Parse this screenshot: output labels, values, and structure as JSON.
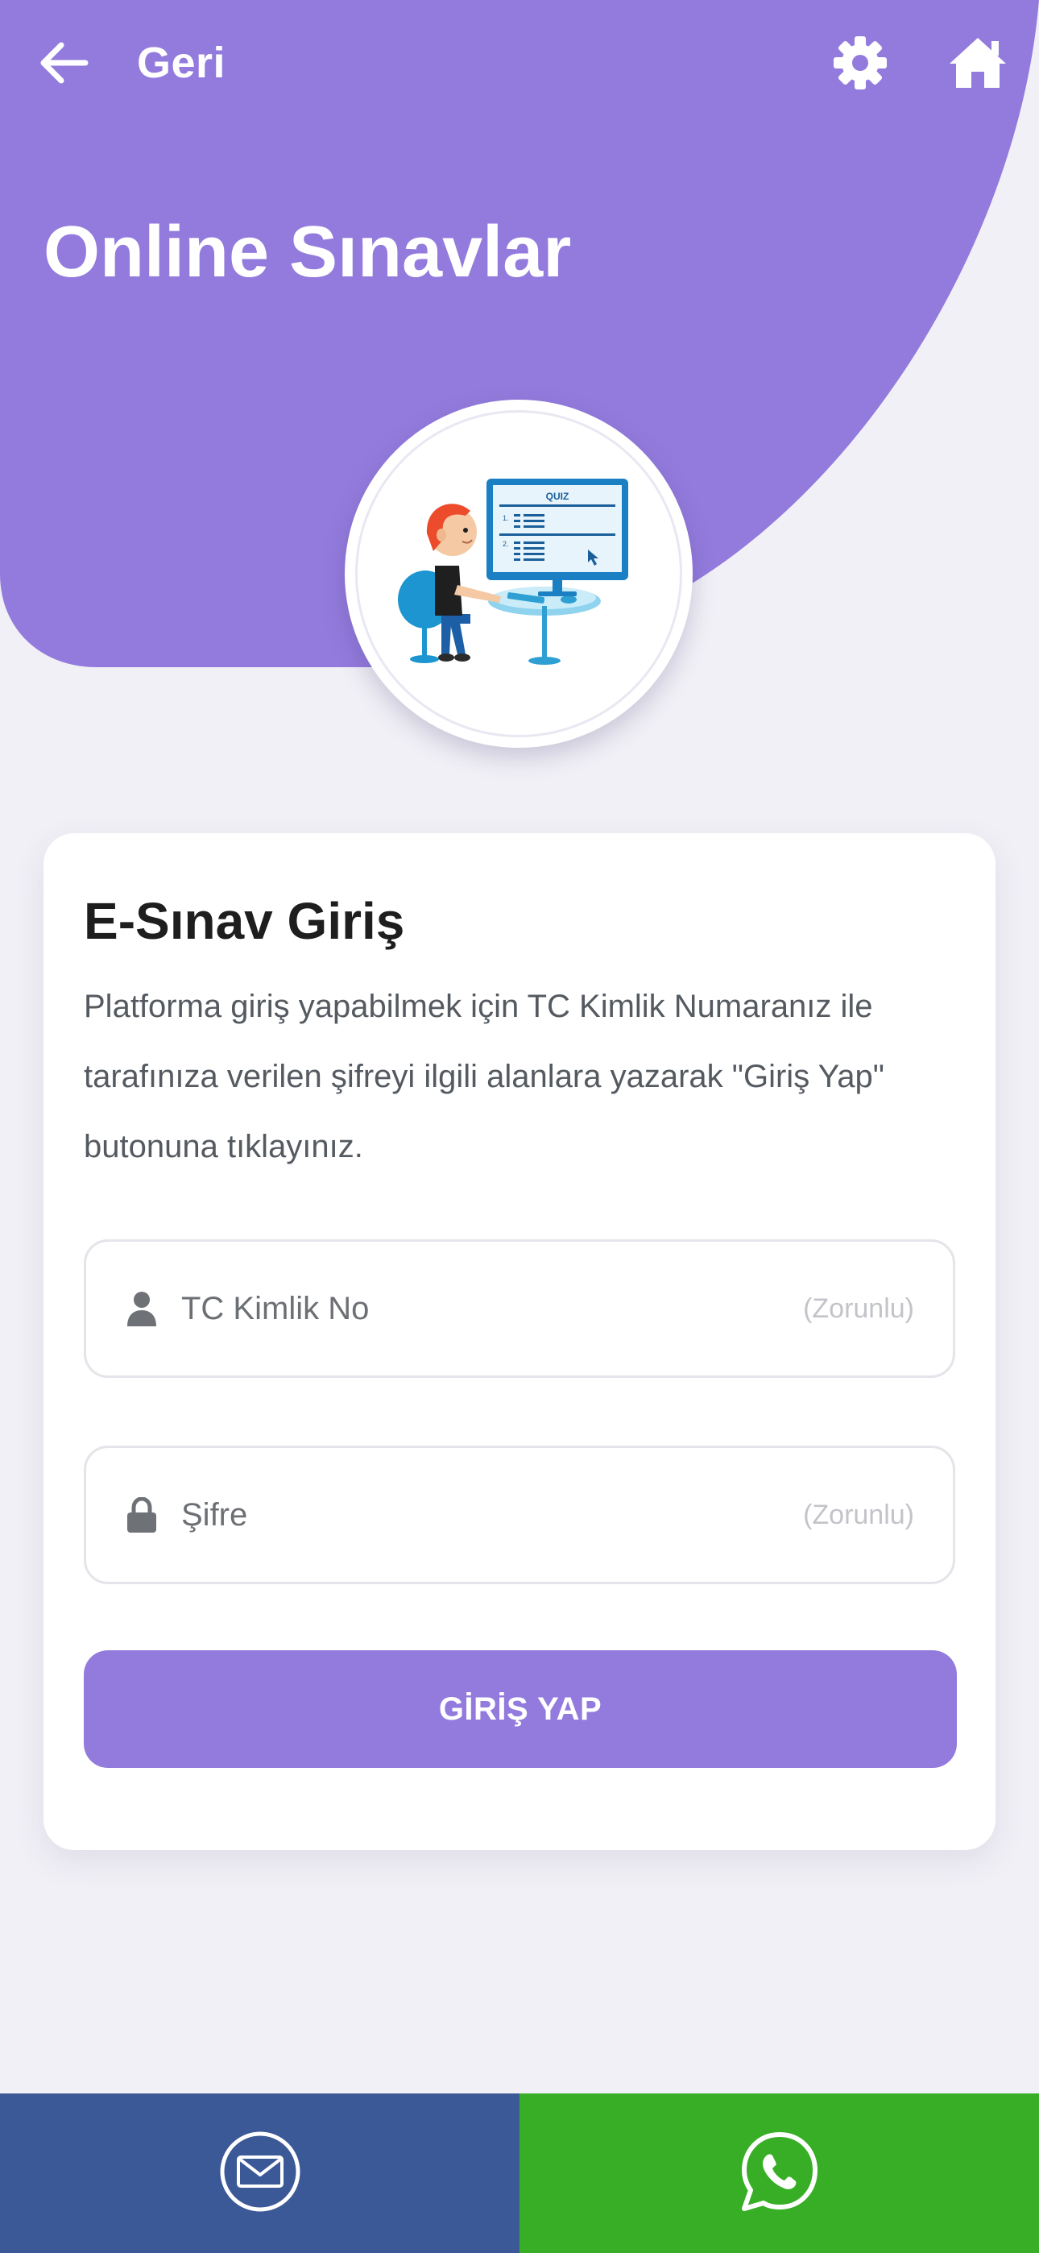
{
  "topbar": {
    "back_label": "Geri",
    "back_icon": "arrow-left-icon",
    "settings_icon": "gear-icon",
    "home_icon": "home-icon"
  },
  "header": {
    "title": "Online Sınavlar",
    "illustration": "quiz-illustration",
    "illustration_text": "QUIZ"
  },
  "login": {
    "title": "E-Sınav Giriş",
    "description": "Platforma giriş yapabilmek için TC Kimlik Numaranız ile tarafınıza verilen şifreyi ilgili alanlara yazarak \"Giriş Yap\" butonuna tıklayınız.",
    "tc_field": {
      "placeholder": "TC Kimlik No",
      "value": "",
      "required_label": "(Zorunlu)",
      "icon": "user-icon"
    },
    "password_field": {
      "placeholder": "Şifre",
      "value": "",
      "required_label": "(Zorunlu)",
      "icon": "lock-icon"
    },
    "submit_label": "GİRİŞ YAP"
  },
  "bottom_bar": {
    "mail_icon": "mail-icon",
    "whatsapp_icon": "whatsapp-icon"
  },
  "colors": {
    "primary": "#937bdd",
    "background": "#f1f0f6",
    "mail": "#3c5997",
    "whatsapp": "#37ae25"
  }
}
